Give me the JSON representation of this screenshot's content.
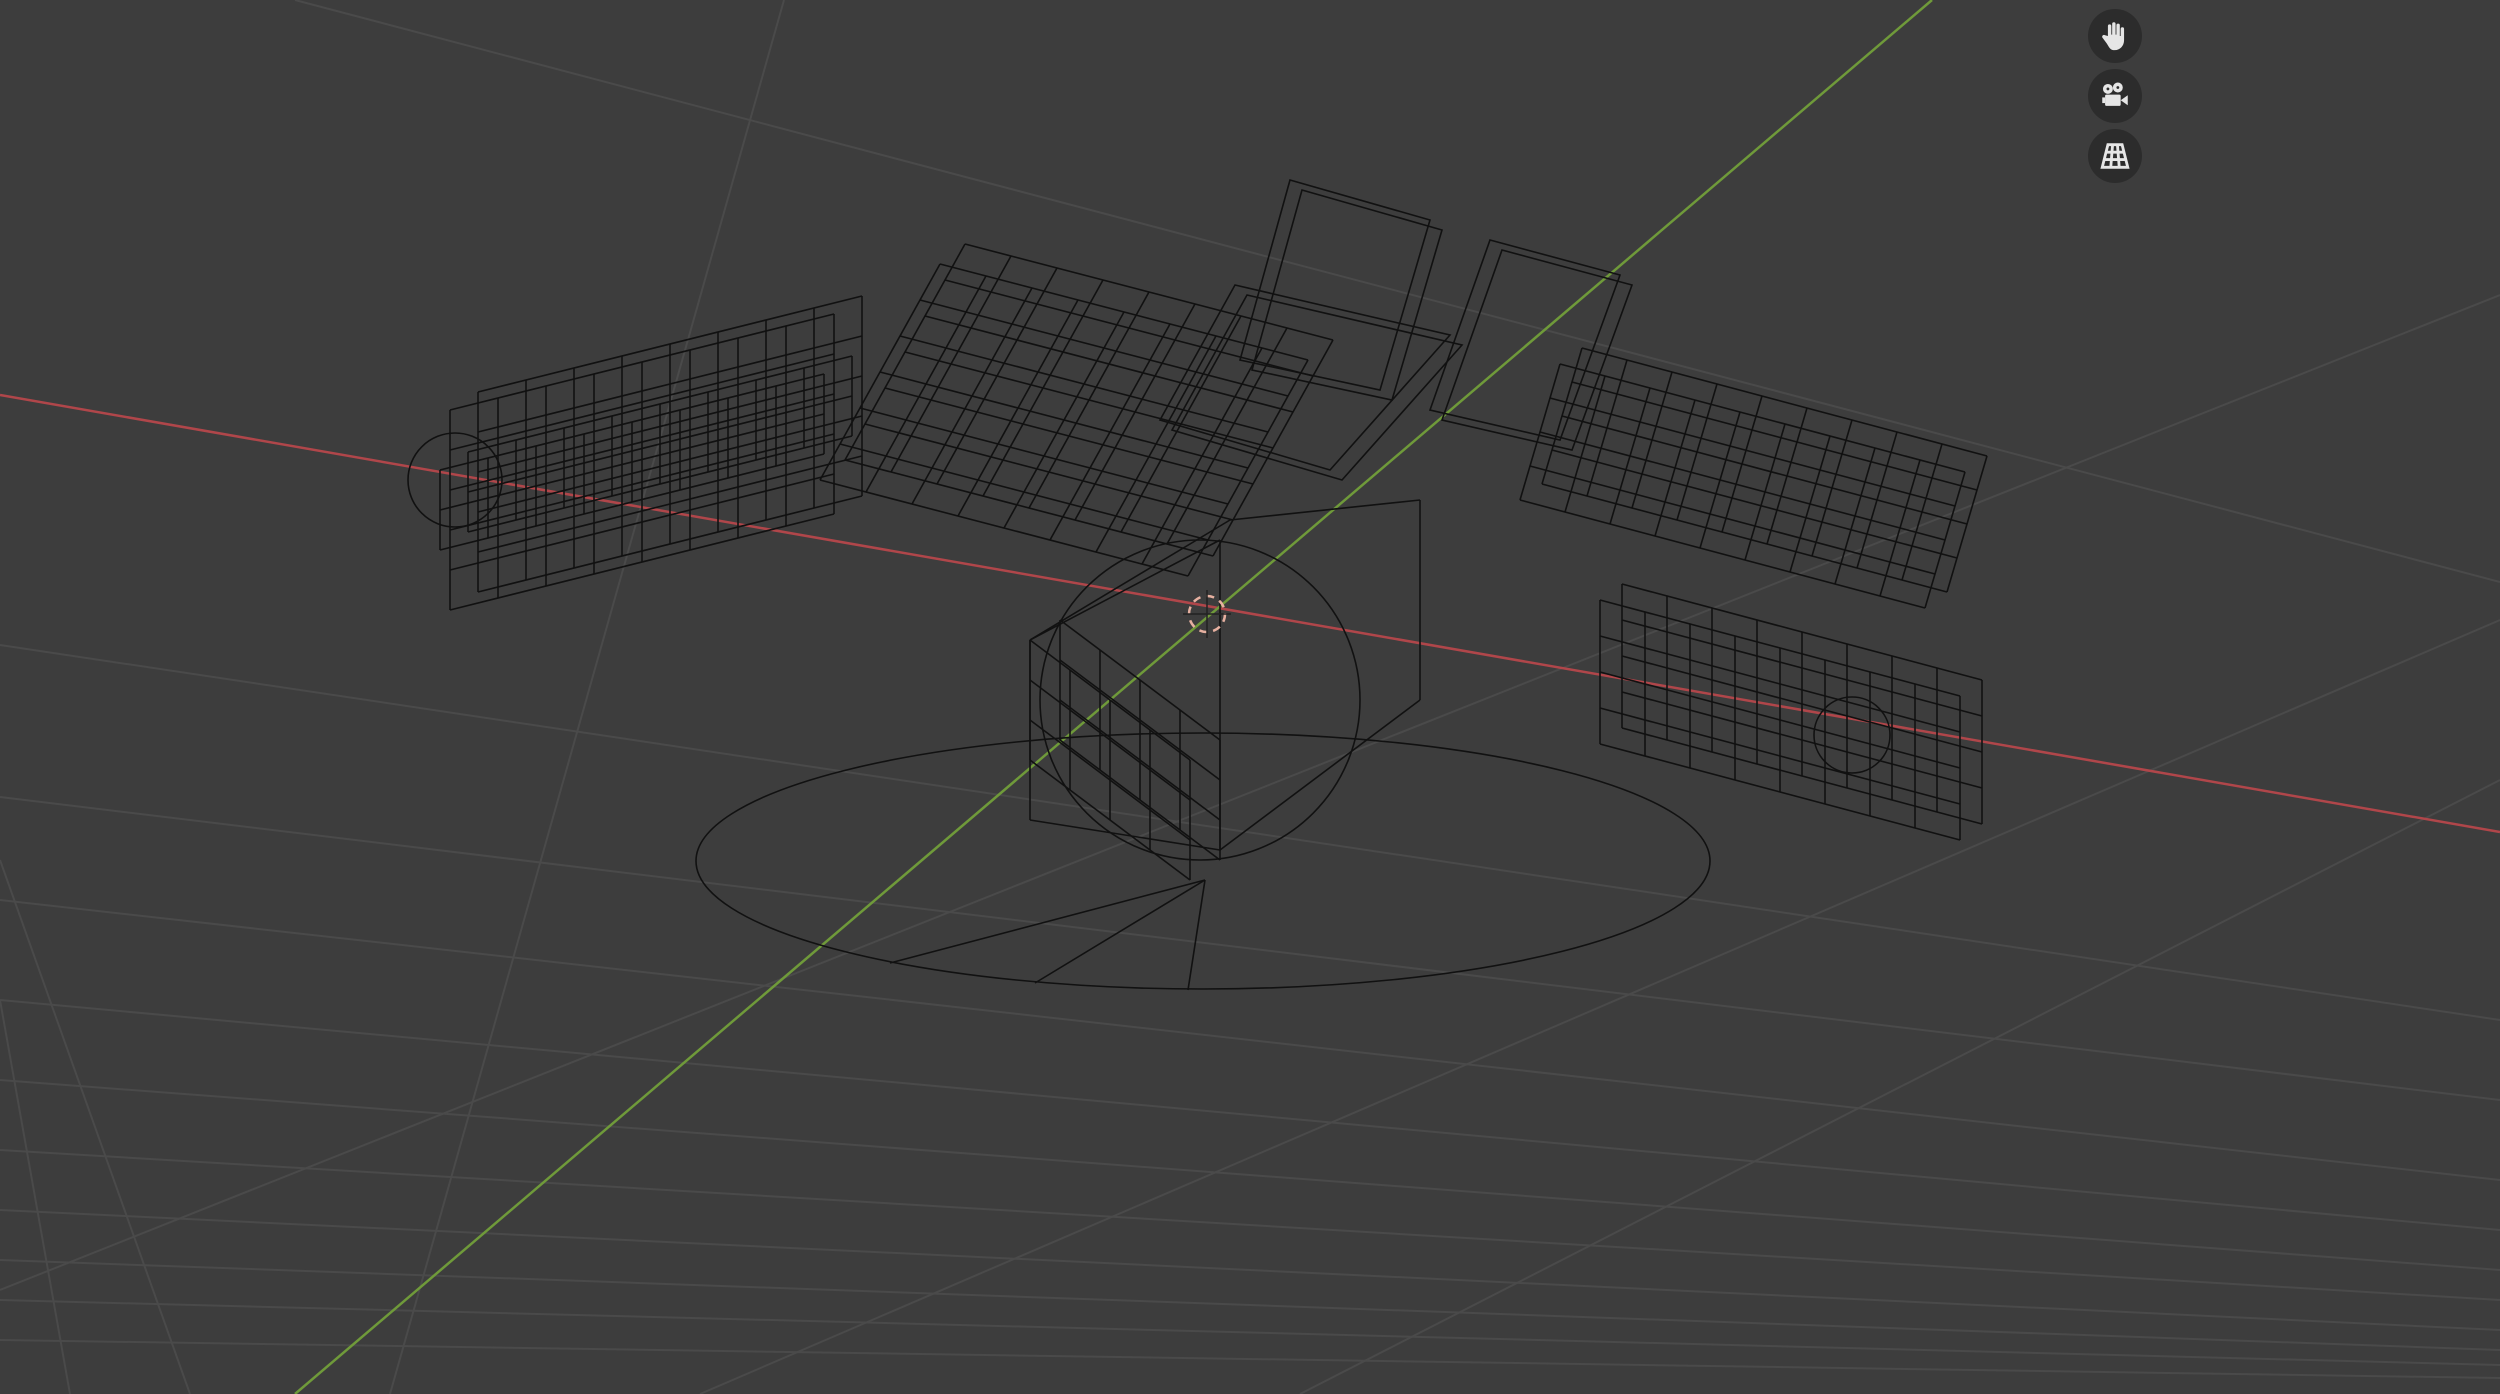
{
  "viewport": {
    "background": "#3d3d3d",
    "grid_color": "#4a4a4a",
    "x_axis_color": "#b0464a",
    "y_axis_color": "#6f9a3a",
    "wire_color": "#111111",
    "cursor_color": "#e6b0a0"
  },
  "navigation_gizmo": {
    "buttons": [
      {
        "icon": "hand-pan-icon"
      },
      {
        "icon": "movie-camera-icon"
      },
      {
        "icon": "perspective-grid-icon"
      }
    ],
    "button_color": "#2c2c2c",
    "icon_color": "#e6e6e6"
  }
}
